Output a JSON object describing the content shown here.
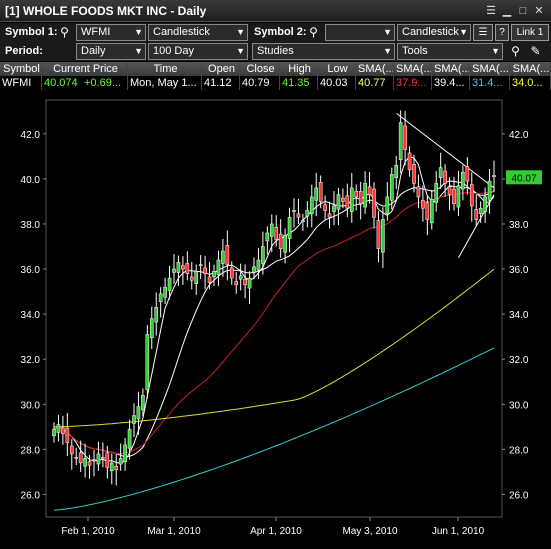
{
  "window": {
    "title": "[1] WHOLE FOODS MKT INC - Daily"
  },
  "toolbar1": {
    "symbol1_label": "Symbol 1:",
    "symbol1_value": "WFMI",
    "chart_type1": "Candlestick",
    "symbol2_label": "Symbol 2:",
    "symbol2_value": "",
    "chart_type2": "Candlestick",
    "help_label": "?",
    "link_label": "Link 1"
  },
  "toolbar2": {
    "period_label": "Period:",
    "period_value": "Daily",
    "range_value": "100 Day",
    "studies_value": "Studies",
    "tools_value": "Tools"
  },
  "quote_table": {
    "headers": [
      "Symbol",
      "Current Price",
      "Time",
      "Open",
      "Close",
      "High",
      "Low",
      "SMA(...",
      "SMA(...",
      "SMA(...",
      "SMA(...",
      "SMA(..."
    ],
    "row": [
      "WFMI",
      "40.074",
      "+0.69...",
      "Mon, May 1...",
      "41.12",
      "40.79",
      "41.35",
      "40.03",
      "40.77",
      "37.9...",
      "39.4...",
      "31.4...",
      "34.0..."
    ],
    "colors": {
      "price": "#66ff33",
      "change": "#66ff33",
      "high": "#66ff33",
      "sma1": "#ffff66",
      "sma2": "#ff3333",
      "sma3": "#ffffff",
      "sma4": "#33ccff",
      "sma5": "#ffff33"
    }
  },
  "chart_data": {
    "type": "candlestick",
    "y_range": [
      25.0,
      43.5
    ],
    "y_ticks": [
      "26.0",
      "28.0",
      "30.0",
      "32.0",
      "34.0",
      "36.0",
      "38.0",
      "40.0",
      "42.0"
    ],
    "x_labels": [
      "Feb 1, 2010",
      "Mar 1, 2010",
      "Apr 1, 2010",
      "May 3, 2010",
      "Jun 1, 2010"
    ],
    "last_price_tag": "40.07",
    "colors": {
      "up": "#33cc33",
      "down": "#ff3333",
      "wick": "#ffffff",
      "sma_white": "#ffffff",
      "sma_red": "#cc2222",
      "sma_yellow": "#dddd33",
      "sma_cyan": "#33cccc",
      "trendline": "#ffffff"
    }
  }
}
